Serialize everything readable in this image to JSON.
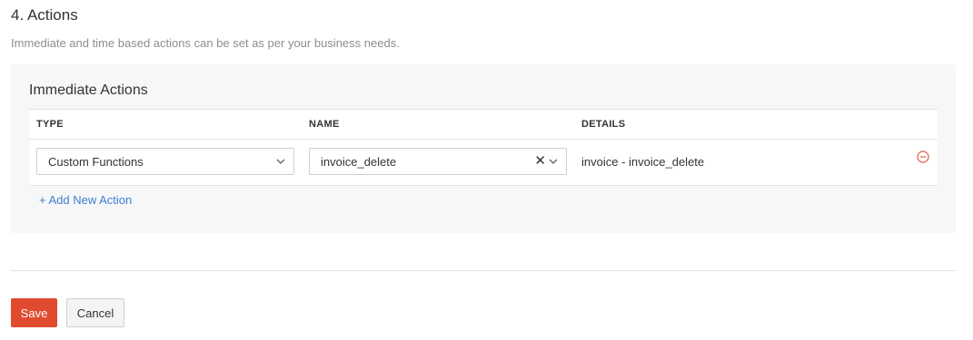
{
  "section": {
    "title": "4. Actions",
    "description": "Immediate and time based actions can be set as per your business needs."
  },
  "immediate_actions": {
    "title": "Immediate Actions",
    "columns": {
      "type": "TYPE",
      "name": "NAME",
      "details": "DETAILS"
    },
    "rows": [
      {
        "type": "Custom Functions",
        "name": "invoice_delete",
        "details": "invoice - invoice_delete"
      }
    ],
    "add_label": "+ Add New Action"
  },
  "icons": {
    "clear": "close-icon",
    "dropdown": "chevron-down-icon",
    "remove": "minus-circle-icon"
  },
  "colors": {
    "primary_button": "#e04a2f",
    "link": "#3f7fd2",
    "remove_icon": "#e25c4d"
  },
  "footer": {
    "save_label": "Save",
    "cancel_label": "Cancel"
  }
}
